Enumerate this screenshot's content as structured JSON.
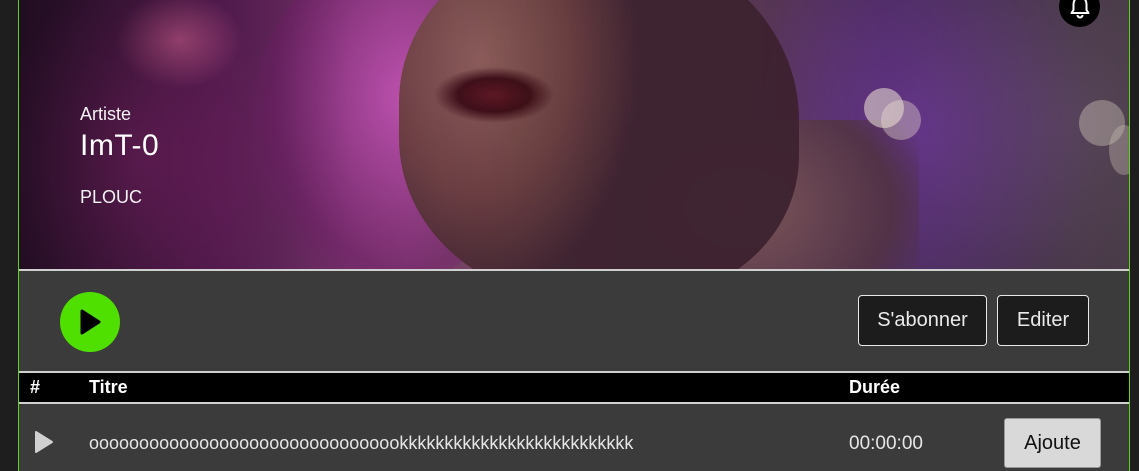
{
  "hero": {
    "kicker": "Artiste",
    "title": "ImT-0",
    "subtitle": "PLOUC"
  },
  "actions": {
    "subscribe_label": "S'abonner",
    "edit_label": "Editer"
  },
  "table": {
    "headers": {
      "number": "#",
      "title": "Titre",
      "duration": "Durée"
    },
    "rows": [
      {
        "title": "oooooooooooooooooooooooooooooookkkkkkkkkkkkkkkkkkkkkkkkkk",
        "duration": "00:00:00",
        "add_label": "Ajoute"
      }
    ]
  },
  "icons": {
    "notification": "bell-icon",
    "play_main": "play-icon",
    "row_play": "play-icon"
  },
  "colors": {
    "accent": "#4fe000",
    "frame_border": "#5bd61a",
    "background": "#3b3b3b",
    "header_bg": "#000000"
  }
}
